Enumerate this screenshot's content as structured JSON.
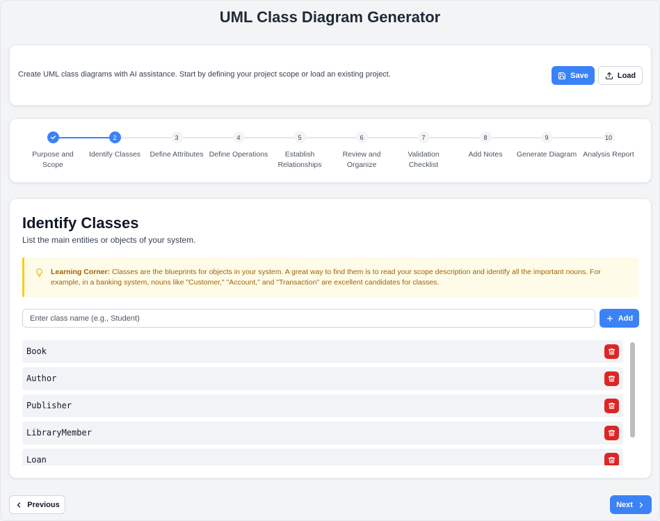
{
  "app": {
    "title": "UML Class Diagram Generator"
  },
  "intro": {
    "text": "Create UML class diagrams with AI assistance. Start by defining your project scope or load an existing project.",
    "save_label": "Save",
    "load_label": "Load"
  },
  "steps": [
    {
      "number": "1",
      "label": "Purpose and Scope",
      "status": "completed"
    },
    {
      "number": "2",
      "label": "Identify Classes",
      "status": "active"
    },
    {
      "number": "3",
      "label": "Define Attributes",
      "status": "pending"
    },
    {
      "number": "4",
      "label": "Define Operations",
      "status": "pending"
    },
    {
      "number": "5",
      "label": "Establish Relationships",
      "status": "pending"
    },
    {
      "number": "6",
      "label": "Review and Organize",
      "status": "pending"
    },
    {
      "number": "7",
      "label": "Validation Checklist",
      "status": "pending"
    },
    {
      "number": "8",
      "label": "Add Notes",
      "status": "pending"
    },
    {
      "number": "9",
      "label": "Generate Diagram",
      "status": "pending"
    },
    {
      "number": "10",
      "label": "Analysis Report",
      "status": "pending"
    }
  ],
  "main": {
    "title": "Identify Classes",
    "subtitle": "List the main entities or objects of your system.",
    "tip_heading": "Learning Corner:",
    "tip_body": " Classes are the blueprints for objects in your system. A great way to find them is to read your scope description and identify all the important nouns. For example, in a banking system, nouns like \"Customer,\" \"Account,\" and \"Transaction\" are excellent candidates for classes.",
    "input_placeholder": "Enter class name (e.g., Student)",
    "input_value": "",
    "add_label": "Add",
    "classes": [
      "Book",
      "Author",
      "Publisher",
      "LibraryMember",
      "Loan"
    ]
  },
  "nav": {
    "previous_label": "Previous",
    "next_label": "Next"
  },
  "colors": {
    "accent": "#3b82f6",
    "danger": "#dc2626",
    "tip_bg": "#fefce8",
    "tip_text": "#a16207"
  },
  "icons": {
    "save": "floppy-disk-icon",
    "load": "upload-icon",
    "tip": "lightbulb-icon",
    "add": "plus-icon",
    "delete": "trash-icon",
    "prev": "chevron-left-icon",
    "next": "chevron-right-icon",
    "done": "check-icon"
  }
}
